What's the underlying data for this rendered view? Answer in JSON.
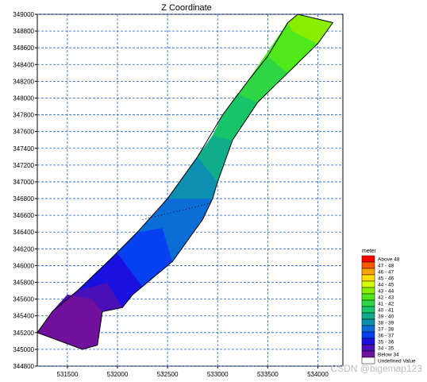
{
  "chart_data": {
    "type": "heatmap",
    "title": "Z Coordinate",
    "xlabel": "",
    "ylabel": "",
    "xlim": [
      531200,
      534250
    ],
    "ylim": [
      344800,
      349000
    ],
    "x_ticks": [
      531500,
      532000,
      532500,
      533000,
      533500,
      534000
    ],
    "y_ticks": [
      344800,
      345000,
      345200,
      345400,
      345600,
      345800,
      346000,
      346200,
      346400,
      346600,
      346800,
      347000,
      347200,
      347400,
      347600,
      347800,
      348000,
      348200,
      348400,
      348600,
      348800,
      349000
    ],
    "grid": true,
    "legend_position": "bottom-right",
    "legend": {
      "title": "meter",
      "entries": [
        {
          "label": "Above 48",
          "color": "#ff0000"
        },
        {
          "label": "47 - 48",
          "color": "#ff5a00"
        },
        {
          "label": "46 - 47",
          "color": "#ffa500"
        },
        {
          "label": "45 - 46",
          "color": "#ffdd00"
        },
        {
          "label": "44 - 45",
          "color": "#d8ff00"
        },
        {
          "label": "43 - 44",
          "color": "#8aee00"
        },
        {
          "label": "42 - 43",
          "color": "#4fe81a"
        },
        {
          "label": "41 - 42",
          "color": "#2ed646"
        },
        {
          "label": "40 - 41",
          "color": "#18c46a"
        },
        {
          "label": "39 - 40",
          "color": "#10ad8a"
        },
        {
          "label": "38 - 39",
          "color": "#0d8fb0"
        },
        {
          "label": "37 - 38",
          "color": "#0a6dd6"
        },
        {
          "label": "36 - 37",
          "color": "#0640f0"
        },
        {
          "label": "35 - 36",
          "color": "#1a10e0"
        },
        {
          "label": "34 - 35",
          "color": "#4a10b8"
        },
        {
          "label": "Below 34",
          "color": "#70109c"
        },
        {
          "label": "Undefined Value",
          "color": "#ffffff"
        }
      ]
    },
    "outline": [
      [
        531200,
        345200
      ],
      [
        531650,
        345000
      ],
      [
        531800,
        345050
      ],
      [
        531850,
        345450
      ],
      [
        532050,
        345500
      ],
      [
        532150,
        345650
      ],
      [
        532250,
        345750
      ],
      [
        532550,
        346050
      ],
      [
        532850,
        346550
      ],
      [
        532950,
        346800
      ],
      [
        533000,
        347000
      ],
      [
        533150,
        347500
      ],
      [
        533400,
        347950
      ],
      [
        533700,
        348300
      ],
      [
        534000,
        348650
      ],
      [
        534150,
        348900
      ],
      [
        533800,
        349000
      ],
      [
        533700,
        348900
      ],
      [
        533500,
        348500
      ],
      [
        533300,
        348200
      ],
      [
        533050,
        347800
      ],
      [
        532800,
        347300
      ],
      [
        532500,
        346800
      ],
      [
        532200,
        346400
      ],
      [
        531950,
        346100
      ],
      [
        531600,
        345700
      ],
      [
        531350,
        345450
      ]
    ],
    "zones": [
      {
        "value_range": "Below 34",
        "polygon": [
          [
            531200,
            345200
          ],
          [
            531650,
            345000
          ],
          [
            531800,
            345050
          ],
          [
            531850,
            345450
          ],
          [
            531750,
            345600
          ],
          [
            531500,
            345650
          ],
          [
            531350,
            345450
          ]
        ]
      },
      {
        "value_range": "34 - 35",
        "polygon": [
          [
            531350,
            345450
          ],
          [
            531500,
            345650
          ],
          [
            531750,
            345600
          ],
          [
            531850,
            345450
          ],
          [
            532050,
            345500
          ],
          [
            531900,
            345800
          ],
          [
            531600,
            345700
          ]
        ]
      },
      {
        "value_range": "35 - 36",
        "polygon": [
          [
            531600,
            345700
          ],
          [
            531900,
            345800
          ],
          [
            532050,
            345500
          ],
          [
            532150,
            345650
          ],
          [
            532250,
            345750
          ],
          [
            532000,
            346150
          ],
          [
            531950,
            346100
          ]
        ]
      },
      {
        "value_range": "36 - 37",
        "polygon": [
          [
            531950,
            346100
          ],
          [
            532000,
            346150
          ],
          [
            532250,
            345750
          ],
          [
            532550,
            346050
          ],
          [
            532450,
            346450
          ],
          [
            532200,
            346400
          ]
        ]
      },
      {
        "value_range": "37 - 38",
        "polygon": [
          [
            532200,
            346400
          ],
          [
            532450,
            346450
          ],
          [
            532550,
            346050
          ],
          [
            532850,
            346550
          ],
          [
            532950,
            346800
          ],
          [
            532500,
            346800
          ]
        ]
      },
      {
        "value_range": "38 - 39",
        "polygon": [
          [
            532500,
            346800
          ],
          [
            532950,
            346800
          ],
          [
            533000,
            347000
          ],
          [
            532800,
            347300
          ]
        ]
      },
      {
        "value_range": "39 - 40",
        "polygon": [
          [
            532800,
            347300
          ],
          [
            533000,
            347000
          ],
          [
            533150,
            347500
          ],
          [
            532950,
            347550
          ]
        ]
      },
      {
        "value_range": "40 - 41",
        "polygon": [
          [
            532950,
            347550
          ],
          [
            533150,
            347500
          ],
          [
            533400,
            347950
          ],
          [
            533200,
            348050
          ],
          [
            533050,
            347800
          ]
        ]
      },
      {
        "value_range": "41 - 42",
        "polygon": [
          [
            533050,
            347800
          ],
          [
            533200,
            348050
          ],
          [
            533400,
            347950
          ],
          [
            533700,
            348300
          ],
          [
            533500,
            348500
          ],
          [
            533300,
            348200
          ]
        ]
      },
      {
        "value_range": "42 - 43",
        "polygon": [
          [
            533300,
            348200
          ],
          [
            533500,
            348500
          ],
          [
            533700,
            348300
          ],
          [
            534000,
            348650
          ],
          [
            533750,
            348800
          ],
          [
            533700,
            348900
          ]
        ]
      },
      {
        "value_range": "43 - 44",
        "polygon": [
          [
            533700,
            348900
          ],
          [
            533750,
            348800
          ],
          [
            534000,
            348650
          ],
          [
            534150,
            348900
          ],
          [
            533800,
            349000
          ]
        ]
      }
    ],
    "dotted_line": [
      [
        532250,
        346550
      ],
      [
        532950,
        346750
      ]
    ]
  },
  "watermark": "CSDN @bigemap123"
}
